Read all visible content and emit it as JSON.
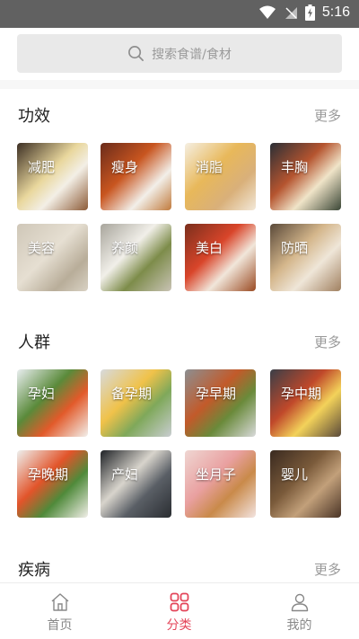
{
  "status_bar": {
    "time": "5:16"
  },
  "search": {
    "placeholder": "搜索食谱/食材"
  },
  "sections": [
    {
      "title": "功效",
      "more": "更多",
      "items": [
        {
          "label": "减肥",
          "bg": "linear-gradient(135deg,#3c2f24 0%,#e9d79d 45%,#f3efe6 65%,#8c5a36 100%)"
        },
        {
          "label": "瘦身",
          "bg": "linear-gradient(135deg,#6a2b1b 0%,#c8551f 40%,#f2efe9 70%,#c07a3c 100%)"
        },
        {
          "label": "消脂",
          "bg": "linear-gradient(135deg,#f5efe3 0%,#e8b85a 40%,#d9b07a 70%,#f3e9d8 100%)"
        },
        {
          "label": "丰胸",
          "bg": "linear-gradient(135deg,#2a2f36 0%,#b5542f 40%,#f0e4c8 65%,#3a4636 100%)"
        },
        {
          "label": "美容",
          "bg": "linear-gradient(135deg,#cfc7b8 0%,#e6dfd2 45%,#b8ad99 75%,#d9d2c4 100%)"
        },
        {
          "label": "养颜",
          "bg": "linear-gradient(135deg,#a8a59c 0%,#f1efe9 40%,#7d8c4a 65%,#c9c3b5 100%)"
        },
        {
          "label": "美白",
          "bg": "linear-gradient(135deg,#7a2f1d 0%,#d9452a 40%,#f1e6da 65%,#9a4a22 100%)"
        },
        {
          "label": "防晒",
          "bg": "linear-gradient(135deg,#5a4a3a 0%,#d4b68b 40%,#efe6d8 65%,#a08060 100%)"
        }
      ]
    },
    {
      "title": "人群",
      "more": "更多",
      "items": [
        {
          "label": "孕妇",
          "bg": "linear-gradient(135deg,#e9eef0 0%,#5a8a3a 40%,#e25a2a 65%,#f2f0ec 100%)"
        },
        {
          "label": "备孕期",
          "bg": "linear-gradient(135deg,#d7dadd 0%,#f0c24a 40%,#7fa85a 65%,#c9cdd1 100%)"
        },
        {
          "label": "孕早期",
          "bg": "linear-gradient(135deg,#8c8f92 0%,#c25a2a 40%,#6a8a3a 65%,#d9dadb 100%)"
        },
        {
          "label": "孕中期",
          "bg": "linear-gradient(135deg,#3a3f48 0%,#c0482a 40%,#f3d25a 65%,#5a4a3a 100%)"
        },
        {
          "label": "孕晚期",
          "bg": "linear-gradient(135deg,#eef0ee 0%,#e2542a 40%,#4f8a3a 65%,#f2efe9 100%)"
        },
        {
          "label": "产妇",
          "bg": "linear-gradient(135deg,#1f2226 0%,#d8d4cc 40%,#5a5f66 65%,#2a2d31 100%)"
        },
        {
          "label": "坐月子",
          "bg": "linear-gradient(135deg,#efd6d2 0%,#e9a0a0 40%,#c98a4a 65%,#f3e4e0 100%)"
        },
        {
          "label": "婴儿",
          "bg": "linear-gradient(135deg,#3a2a20 0%,#7a5a3a 40%,#c2a07a 65%,#4a3426 100%)"
        }
      ]
    },
    {
      "title": "疾病",
      "more": "更多",
      "items": []
    }
  ],
  "tabbar": {
    "items": [
      {
        "label": "首页",
        "icon": "home-icon",
        "active": false
      },
      {
        "label": "分类",
        "icon": "category-grid-icon",
        "active": true
      },
      {
        "label": "我的",
        "icon": "user-icon",
        "active": false
      }
    ],
    "active_color": "#e4465a",
    "inactive_color": "#888888"
  }
}
